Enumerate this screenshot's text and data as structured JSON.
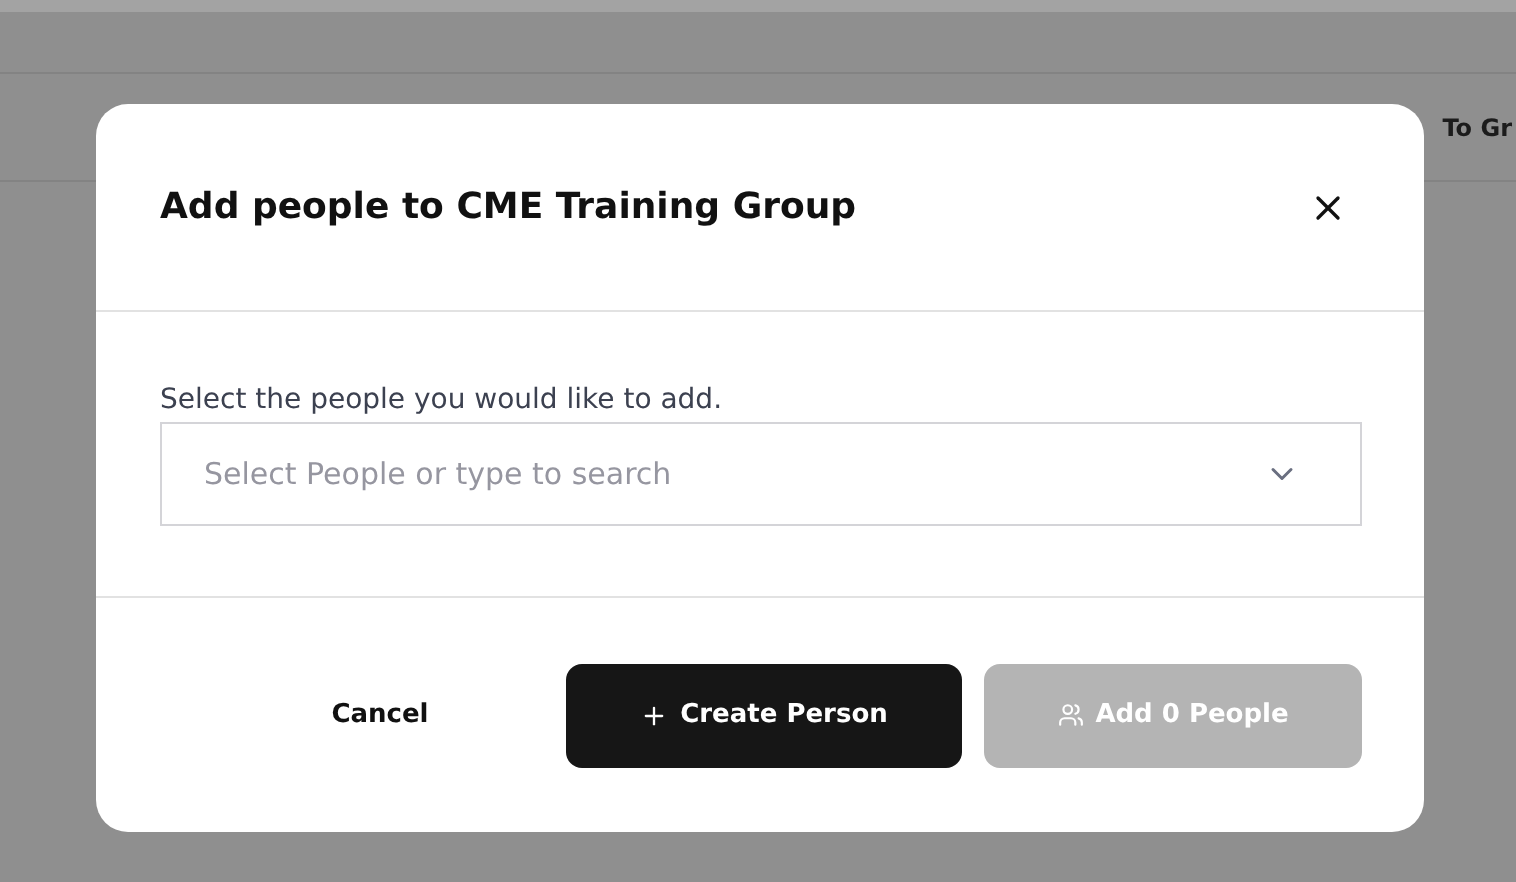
{
  "background": {
    "header_text": "To Gr"
  },
  "dialog": {
    "title": "Add people to CME Training Group",
    "field": {
      "label": "Select the people you would like to add.",
      "placeholder": "Select People or type to search"
    },
    "buttons": [
      {
        "kind": "text",
        "label": "Cancel",
        "disabled": false
      },
      {
        "kind": "create",
        "label": "Create Person",
        "disabled": false
      },
      {
        "kind": "add",
        "label": "Add 0 People",
        "disabled": true
      }
    ]
  }
}
